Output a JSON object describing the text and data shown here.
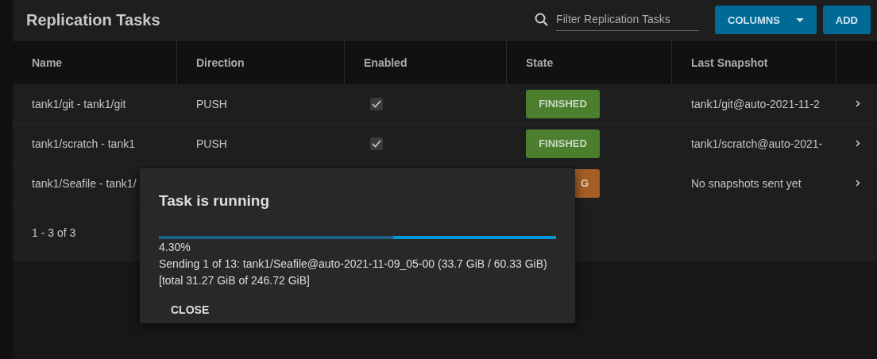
{
  "header": {
    "title": "Replication Tasks",
    "search": {
      "placeholder": "Filter Replication Tasks"
    },
    "buttons": [
      {
        "label": "COLUMNS",
        "kind": "dropdown"
      },
      {
        "label": "ADD",
        "kind": "plain"
      }
    ]
  },
  "table": {
    "columns": [
      "Name",
      "Direction",
      "Enabled",
      "State",
      "Last Snapshot"
    ],
    "rows": [
      {
        "name": "tank1/git - tank1/git",
        "direction": "PUSH",
        "enabled": true,
        "state": {
          "label": "FINISHED",
          "kind": "finished"
        },
        "last_snapshot": "tank1/git@auto-2021-11-2"
      },
      {
        "name": "tank1/scratch - tank1",
        "direction": "PUSH",
        "enabled": true,
        "state": {
          "label": "FINISHED",
          "kind": "finished"
        },
        "last_snapshot": "tank1/scratch@auto-2021-"
      },
      {
        "name": "tank1/Seafile - tank1/",
        "state": {
          "label": "G",
          "kind": "running"
        },
        "last_snapshot": "No snapshots sent yet"
      }
    ],
    "paginator": "1 - 3 of 3"
  },
  "dialog": {
    "title": "Task is running",
    "progress": {
      "level": 0.59
    },
    "percent": "4.30%",
    "message": "Sending 1 of 13: tank1/Seafile@auto-2021-11-09_05-00 (33.7 GiB / 60.33 GiB)",
    "total": "[total 31.27 GiB of 246.72 GiB]",
    "button": "CLOSE"
  }
}
